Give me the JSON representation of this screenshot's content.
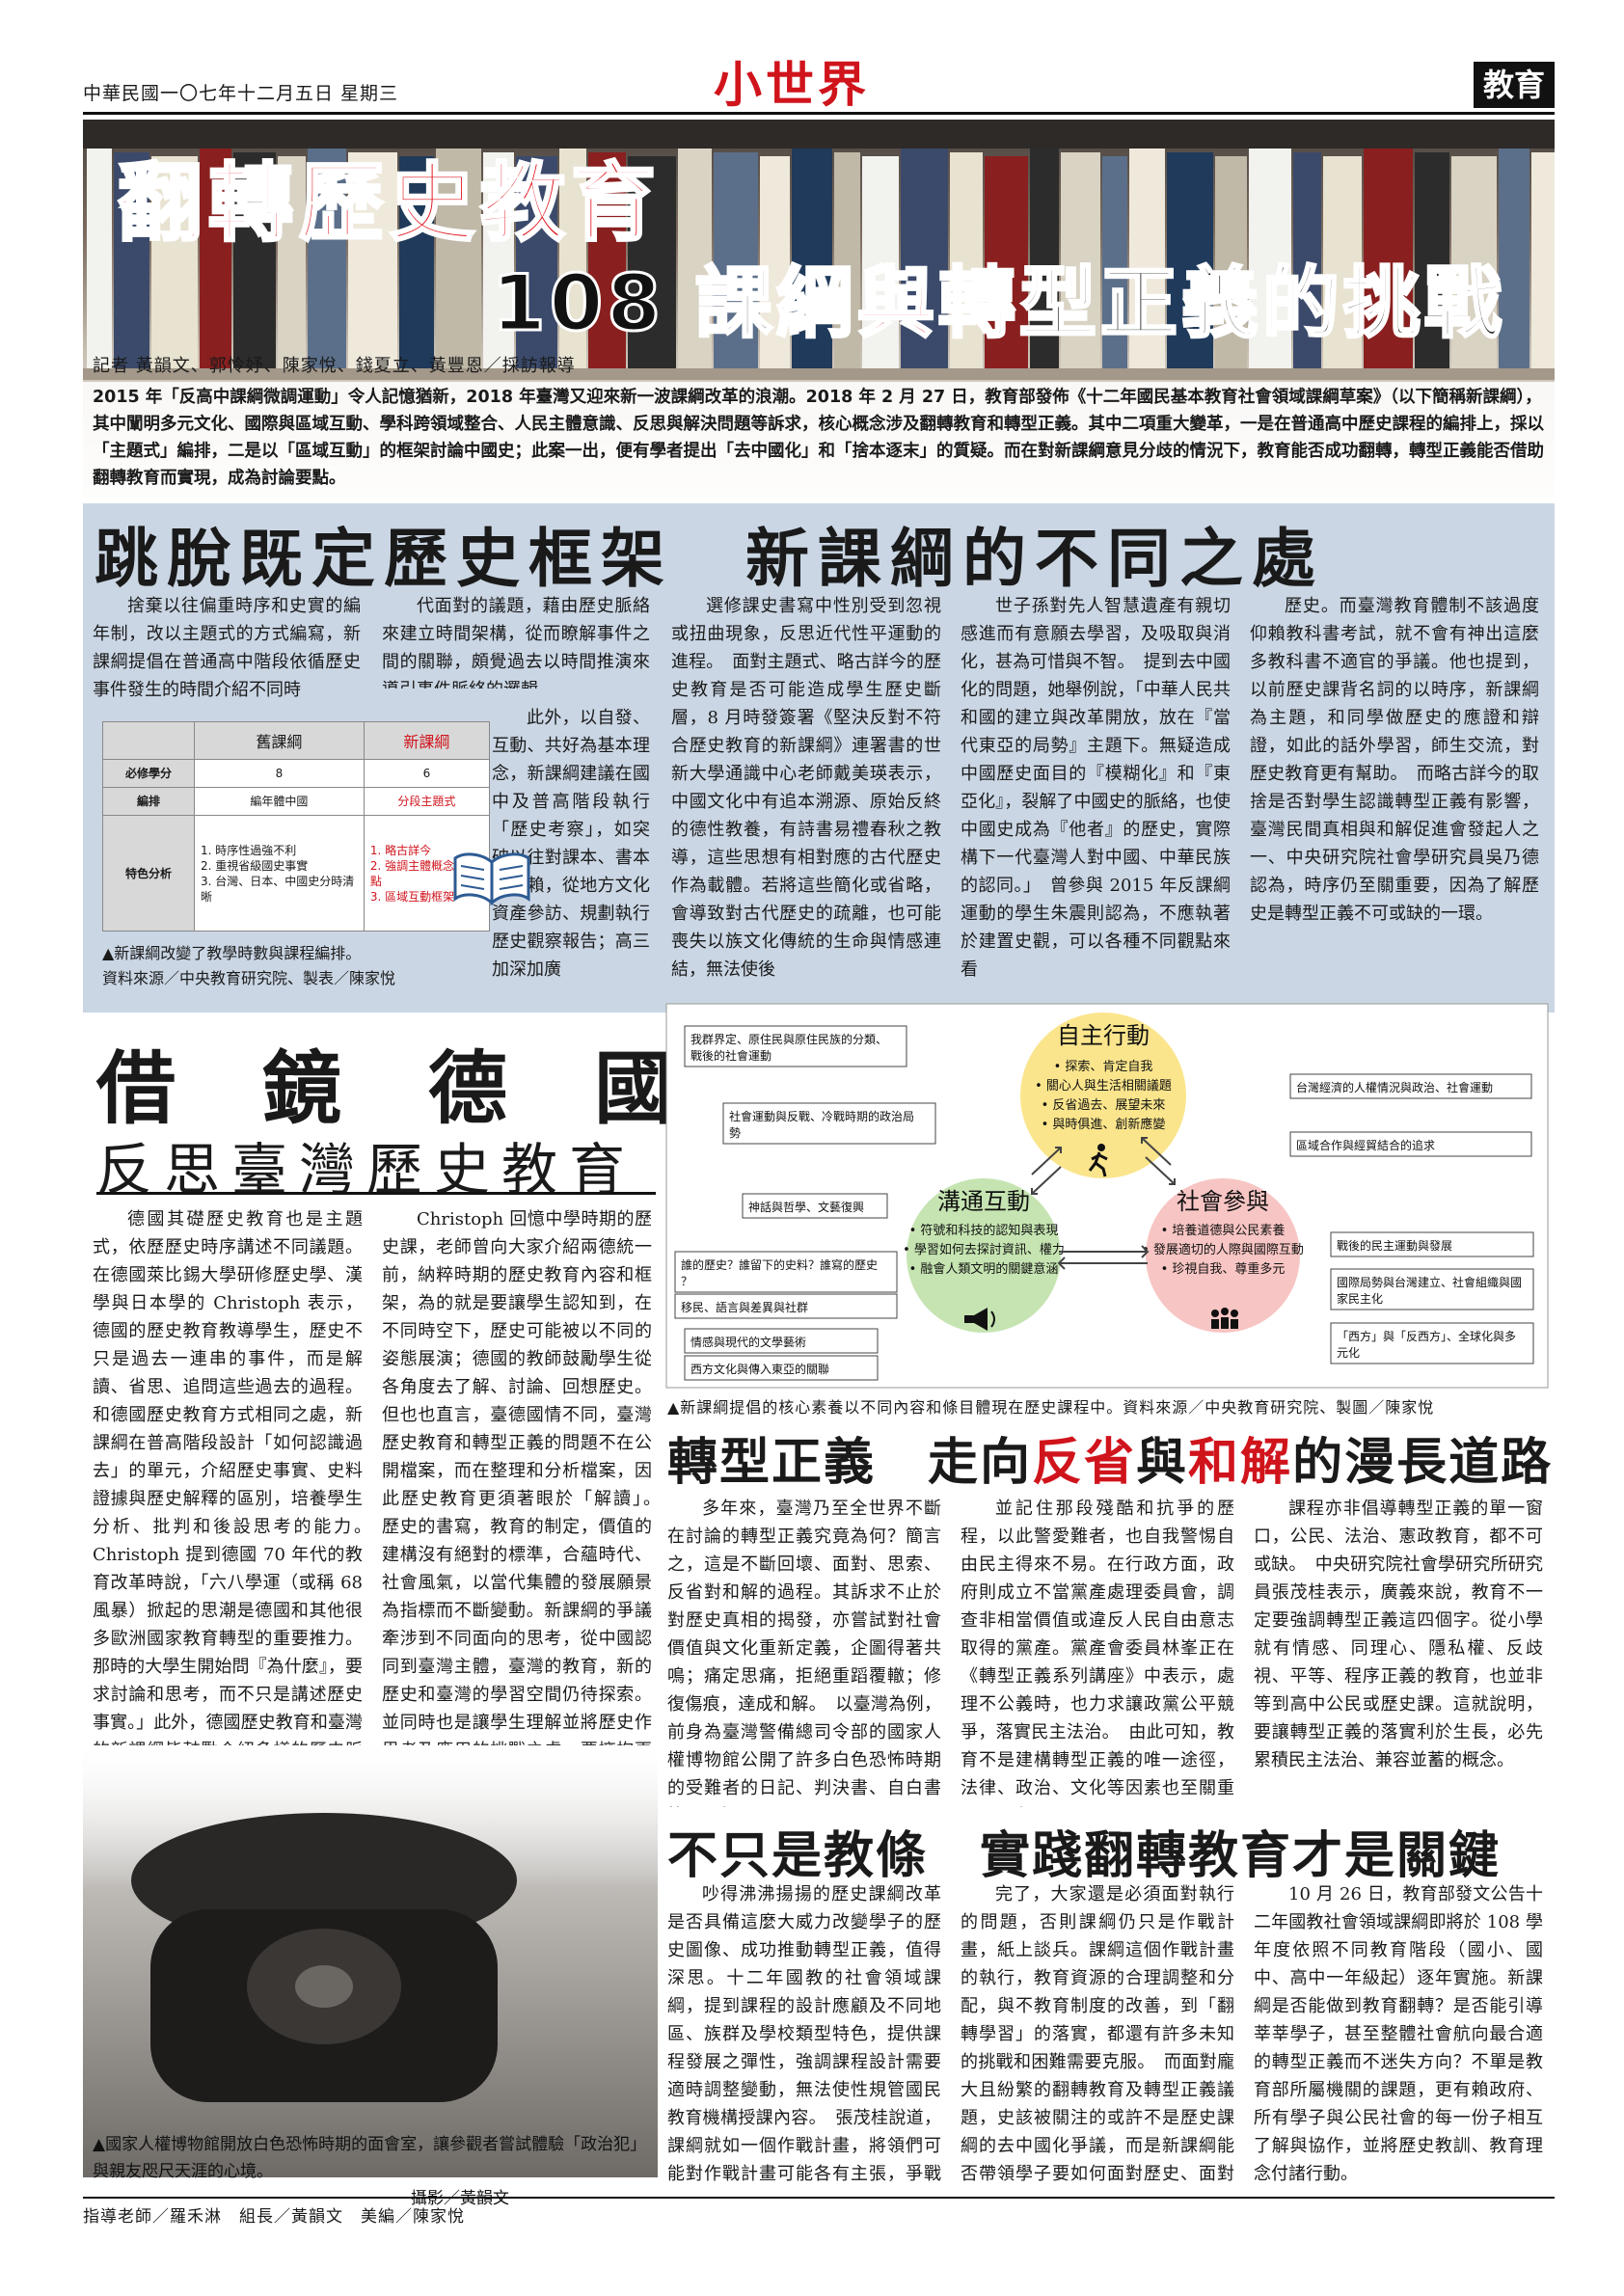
{
  "masthead": {
    "date": "中華民國一〇七年十二月五日 星期三",
    "logo": "小世界",
    "section": "教育"
  },
  "hero": {
    "title_line1": "翻轉歷史教育",
    "title_line2_a": "108 課綱",
    "title_line2_b": "與",
    "title_line2_c": "轉型正義",
    "title_line2_d": "的挑戰",
    "reporters": "記者 黃韻文、郭怜妤、陳家悅、錢夏立、黃豐恩／採訪報導",
    "lead": "2015 年「反高中課綱微調運動」令人記憶猶新，2018 年臺灣又迎來新一波課綱改革的浪潮。2018 年 2 月 27 日，教育部發佈《十二年國民基本教育社會領域課綱草案》（以下簡稱新課綱），其中闡明多元文化、國際與區域互動、學科跨領域整合、人民主體意識、反思與解決問題等訴求，核心概念涉及翻轉教育和轉型正義。其中二項重大變革，一是在普通高中歷史課程的編排上，採以「主題式」編排，二是以「區域互動」的框架討論中國史；此案一出，便有學者提出「去中國化」和「捨本逐末」的質疑。而在對新課綱意見分歧的情況下，教育能否成功翻轉，轉型正義能否借助翻轉教育而實現，成為討論要點。"
  },
  "section1": {
    "heading": "跳脫既定歷史框架　新課綱的不同之處",
    "col1": "捨棄以往偏重時序和史實的編年制，改以主題式的方式編寫，新課綱提倡在普通高中階段依循歷史事件發生的時間介紹不同時",
    "col2a": "代面對的議題，藉由歷史脈絡來建立時間架構，從而瞭解事件之間的關聯，頗覺過去以時間推演來導引事件脈絡的邏輯。",
    "col2b": "此外，以自發、互動、共好為基本理念，新課綱建議在國中及普高階段執行「歷史考察」，如突破以往對課本、書本的依賴，從地方文化資產參訪、規劃執行歷史觀察報告；高三加深加廣",
    "col3": "選修課史書寫中性別受到忽視或扭曲現象，反思近代性平運動的進程。　面對主題式、略古詳今的歷史教育是否可能造成學生歷史斷層，8 月時發簽署《堅決反對不符合歷史教育的新課綱》連署書的世新大學通識中心老師戴美瑛表示，中國文化中有追本溯源、原始反終的德性教養，有詩書易禮春秋之教導，這些思想有相對應的古代歷史作為載體。若將這些簡化或省略，會導致對古代歷史的疏離，也可能喪失以族文化傳統的生命與情感連結，無法使後",
    "col4": "世子孫對先人智慧遺產有親切感進而有意願去學習，及吸取與消化，甚為可惜與不智。　提到去中國化的問題，她舉例說，「中華人民共和國的建立與改革開放，放在『當代東亞的局勢』主題下。無疑造成中國歷史面目的『模糊化』和『東亞化』，裂解了中國史的脈絡，也使中國史成為『他者』的歷史，實際構下一代臺灣人對中國、中華民族的認同。」　曾參與 2015 年反課綱運動的學生朱震則認為，不應執著於建置史觀，可以各種不同觀點來看",
    "col5": "歷史。而臺灣教育體制不該過度仰賴教科書考試，就不會有神出這麼多教科書不適官的爭議。他也提到，以前歷史課背名詞的以時序，新課綱為主題，和同學做歷史的應證和辯證，如此的話外學習，師生交流，對歷史教育更有幫助。　而略古詳今的取捨是否對學生認識轉型正義有影響，臺灣民間真相與和解促進會發起人之一、中央研究院社會學研究員吳乃德認為，時序仍至關重要，因為了解歷史是轉型正義不可或缺的一環。",
    "table": {
      "col_old": "舊課綱",
      "col_new": "新課綱",
      "rows": [
        {
          "label": "必修學分",
          "old": "8",
          "new": "6"
        },
        {
          "label": "編排",
          "old": "編年體中國",
          "new": "分段主題式"
        },
        {
          "label": "特色分析",
          "old": [
            "1. 時序性過強不利",
            "2. 重視省級國史事實",
            "3. 台灣、日本、中國史分時清晰"
          ],
          "new": [
            "1. 略古詳今",
            "2. 強調主體概念訴觀點",
            "3. 區域互動框架"
          ]
        }
      ]
    },
    "caption": "▲新課綱改變了教學時數與課程編排。\n資料來源／中央教育研究院、製表／陳家悅"
  },
  "section2": {
    "heading1": "借鏡德國",
    "heading2": "反思臺灣歷史教育",
    "col1": "德國其礎歷史教育也是主題式，依歷歷史時序講述不同議題。在德國萊比錫大學研修歷史學、漢學與日本學的 Christoph 表示，德國的歷史教育教導學生，歷史不只是過去一連串的事件，而是解讀、省思、追問這些過去的過程。和德國歷史教育方式相同之處，新課綱在普高階段設計「如何認識過去」的單元，介紹歷史事實、史料證據與歷史解釋的區別，培養學生分析、批判和後設思考的能力。　Christoph 提到德國 70 年代的教育改革時說，「六八學運（或稱 68 風暴）掀起的思潮是德國和其他很多歐洲國家教育轉型的重要推力。那時的大學生開始問『為什麼』，要求討論和思考，而不只是講述歷史事實。」此外，德國歷史教育和臺灣的新課綱皆鼓勵介紹多樣的歷史脈絡。",
    "col2": "Christoph 回憶中學時期的歷史課，老師曾向大家介紹兩德統一前，納粹時期的歷史教育內容和框架，為的就是要讓學生認知到，在不同時空下，歷史可能被以不同的姿態展演；德國的教師鼓勵學生從各角度去了解、討論、回想歷史。但也也直言，臺德國情不同，臺灣歷史教育和轉型正義的問題不在公開檔案，而在整理和分析檔案，因此歷史教育更須著眼於「解讀」。　歷史的書寫，教育的制定，價值的建構沒有絕對的標準，合蘊時代、社會風氣，以當代集體的發展願景為指標而不斷變動。新課綱的爭議牽涉到不同面向的思考，從中國認同到臺灣主體，臺灣的教育，新的歷史和臺灣的學習空間仍待探索。並同時也是讓學生理解並將歷史作思考及應用的挑戰之處，要擁抱更多元的社會價值觀來回應當下的問題。臺灣國內教育的主體性是什麼？理解國際和臺灣的問題點是什麼？和特定的意識或認同，而是告訴學生從歷史認知，認同是否重要，及如何批判性思考。"
  },
  "diagram": {
    "center_top": "自主行動",
    "center_left": "溝通互動",
    "center_right": "社會參與",
    "top_items": [
      "探索、肯定自我",
      "關心人與生活相關議題",
      "反省過去、展望未來",
      "與時俱進、創新應變"
    ],
    "left_items": [
      "符號和科技的認知與表現",
      "學習如何去探討資訊、權力",
      "融會人類文明的關鍵意涵"
    ],
    "right_items": [
      "培養道德與公民素養",
      "發展適切的人際與國際互動",
      "珍視自我、尊重多元"
    ],
    "topleft_boxes": [
      "我群界定、原住民與原住民族的分類、戰後的社會運動",
      "社會運動與反戰、冷戰時期的政治局勢"
    ],
    "topright_boxes": [
      "台灣經濟的人權情況與政治、社會運動",
      "區域合作與經貿結合的追求"
    ],
    "left_boxes": [
      "神話與哲學、文藝復興",
      "誰的歷史？誰留下的史料？誰寫的歷史？",
      "移民、語言與差異與社群"
    ],
    "left_boxes_b": [
      "情感與現代的文學藝術",
      "西方文化與傳入東亞的關聯"
    ],
    "right_boxes": [
      "戰後的民主運動與發展",
      "國際局勢與台灣建立、社會組織與國家民主化",
      "「西方」與「反西方」、全球化與多元化"
    ],
    "caption": "▲新課綱提倡的核心素養以不同內容和條目體現在歷史課程中。資料來源／中央教育研究院、製圖／陳家悅"
  },
  "section3": {
    "heading_a": "轉型正義　走向",
    "heading_b": "反省",
    "heading_c": "與",
    "heading_d": "和解",
    "heading_e": "的漫長道路",
    "col1": "多年來，臺灣乃至全世界不斷在討論的轉型正義究竟為何？簡言之，這是不斷回壞、面對、思索、反省對和解的過程。其訴求不止於對歷史真相的揭發，亦嘗試對社會價值與文化重新定義，企圖得著共鳴；痛定思痛，拒絕重蹈覆轍；修復傷痕，達成和解。　以臺灣為例，前身為臺灣警備總司令部的國家人權博物館公開了許多白色恐怖時期的受難者的日記、判決書、自白書等，回顧",
    "col2": "並記住那段殘酷和抗爭的歷程，以此警愛難者，也自我警惕自由民主得來不易。在行政方面，政府則成立不當黨產處理委員會，調查非相當價值或違反人民自由意志取得的黨產。黨產會委員林峯正在《轉型正義系列講座》中表示，處理不公義時，也力求讓政黨公平競爭，落實民主法治。　由此可知，教育不是建構轉型正義的唯一途徑，法律、政治、文化等因素也至關重要；歷史",
    "col3": "課程亦非倡導轉型正義的單一窗口，公民、法治、憲政教育，都不可或缺。　中央研究院社會學研究所研究員張茂桂表示，廣義來說，教育不一定要強調轉型正義這四個字。從小學就有情感、同理心、隱私權、反歧視、平等、程序正義的教育，也並非等到高中公民或歷史課。這就說明，要讓轉型正義的落實利於生長，必先累積民主法治、兼容並蓄的概念。"
  },
  "section4": {
    "heading": "不只是教條　實踐翻轉教育才是關鍵",
    "col1": "吵得沸沸揚揚的歷史課綱改革是否具備這麼大威力改變學子的歷史圖像、成功推動轉型正義，值得深思。十二年國教的社會領域課綱，提到課程的設計應顧及不同地區、族群及學校類型特色，提供課程發展之彈性，強調課程設計需要適時調整變動，無法使性規管國民教育機構授課內容。　張茂桂說道，課綱就如一個作戰計畫，將領們可能對作戰計畫可能各有主張，爭戰不休。但事",
    "col2": "完了，大家還是必須面對執行的問題，否則課綱仍只是作戰計畫，紙上談兵。課綱這個作戰計畫的執行，教育資源的合理調整和分配，與不教育制度的改善，到「翻轉學習」的落實，都還有許多未知的挑戰和困難需要克服。　而面對龐大且紛繁的翻轉教育及轉型正義議題，史該被關注的或許不是歷史課綱的去中國化爭議，而是新課綱能否帶領學子要如何面對歷史、面對過往。",
    "col3": "10 月 26 日，教育部發文公告十二年國教社會領域課綱即將於 108 學年度依照不同教育階段（國小、國中、高中一年級起）逐年實施。新課綱是否能做到教育翻轉？是否能引導莘莘學子，甚至整體社會航向最合適的轉型正義而不迷失方向？不單是教育部所屬機關的課題，更有賴政府、所有學子與公民社會的每一份子相互了解與協作，並將歷史教訓、教育理念付諸行動。"
  },
  "photo_caption": "▲國家人權博物館開放白色恐怖時期的面會室，讓參觀者嘗試體驗「政治犯」與親友咫尺天涯的心境。",
  "photo_credit": "攝影／黃韻文",
  "footer": "指導老師／羅禾淋　組長／黃韻文　美編／陳家悅",
  "colors": {
    "red": "#d0141c",
    "section_blue": "#cad6e4",
    "circle_yellow": "#fbe58c",
    "circle_green": "#c5e4b1",
    "circle_pink": "#f7c5c3"
  }
}
